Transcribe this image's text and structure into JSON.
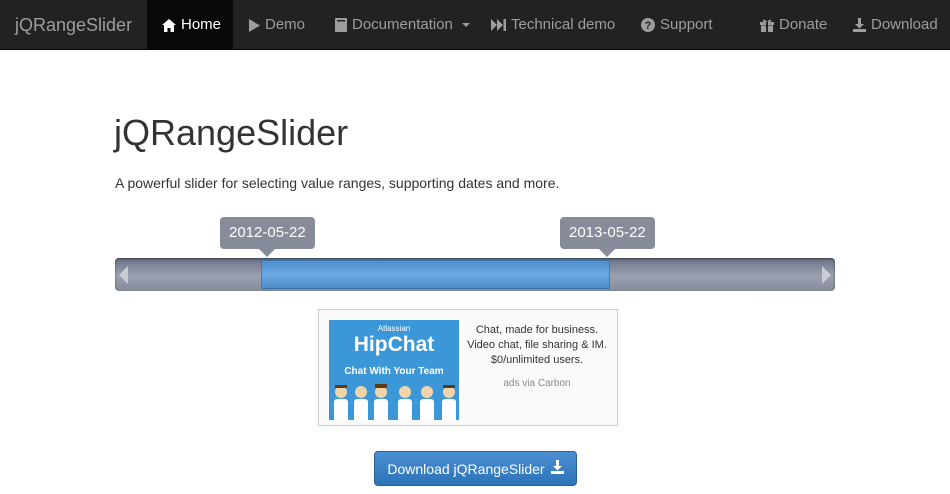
{
  "navbar": {
    "brand": "jQRangeSlider",
    "items": [
      {
        "label": "Home",
        "icon": "home-icon",
        "active": true
      },
      {
        "label": "Demo",
        "icon": "play-icon"
      },
      {
        "label": "Documentation",
        "icon": "book-icon",
        "dropdown": true
      },
      {
        "label": "Technical demo",
        "icon": "fast-forward-icon"
      },
      {
        "label": "Support",
        "icon": "question-circle-icon"
      },
      {
        "label": "Donate",
        "icon": "gift-icon"
      },
      {
        "label": "Download",
        "icon": "download-icon"
      }
    ]
  },
  "main": {
    "title": "jQRangeSlider",
    "lead": "A powerful slider for selecting value ranges, supporting dates and more."
  },
  "slider": {
    "min_label": "2012-05-22",
    "max_label": "2013-05-22",
    "range_start_fraction": 0.203,
    "range_end_fraction": 0.687
  },
  "ad": {
    "image_brand_small": "Atlassian",
    "image_brand": "HipChat",
    "image_tagline": "Chat With Your Team",
    "text_line1": "Chat, made for business.",
    "text_line2": "Video chat, file sharing & IM.",
    "text_line3": "$0/unlimited users.",
    "via": "ads via Carbon"
  },
  "download_button": {
    "label": "Download jQRangeSlider",
    "icon": "download-icon"
  },
  "colors": {
    "navbar_bg": "#222222",
    "active_bg": "#080808",
    "range_blue": "#5b9fe0",
    "button_blue": "#3a80c8"
  }
}
